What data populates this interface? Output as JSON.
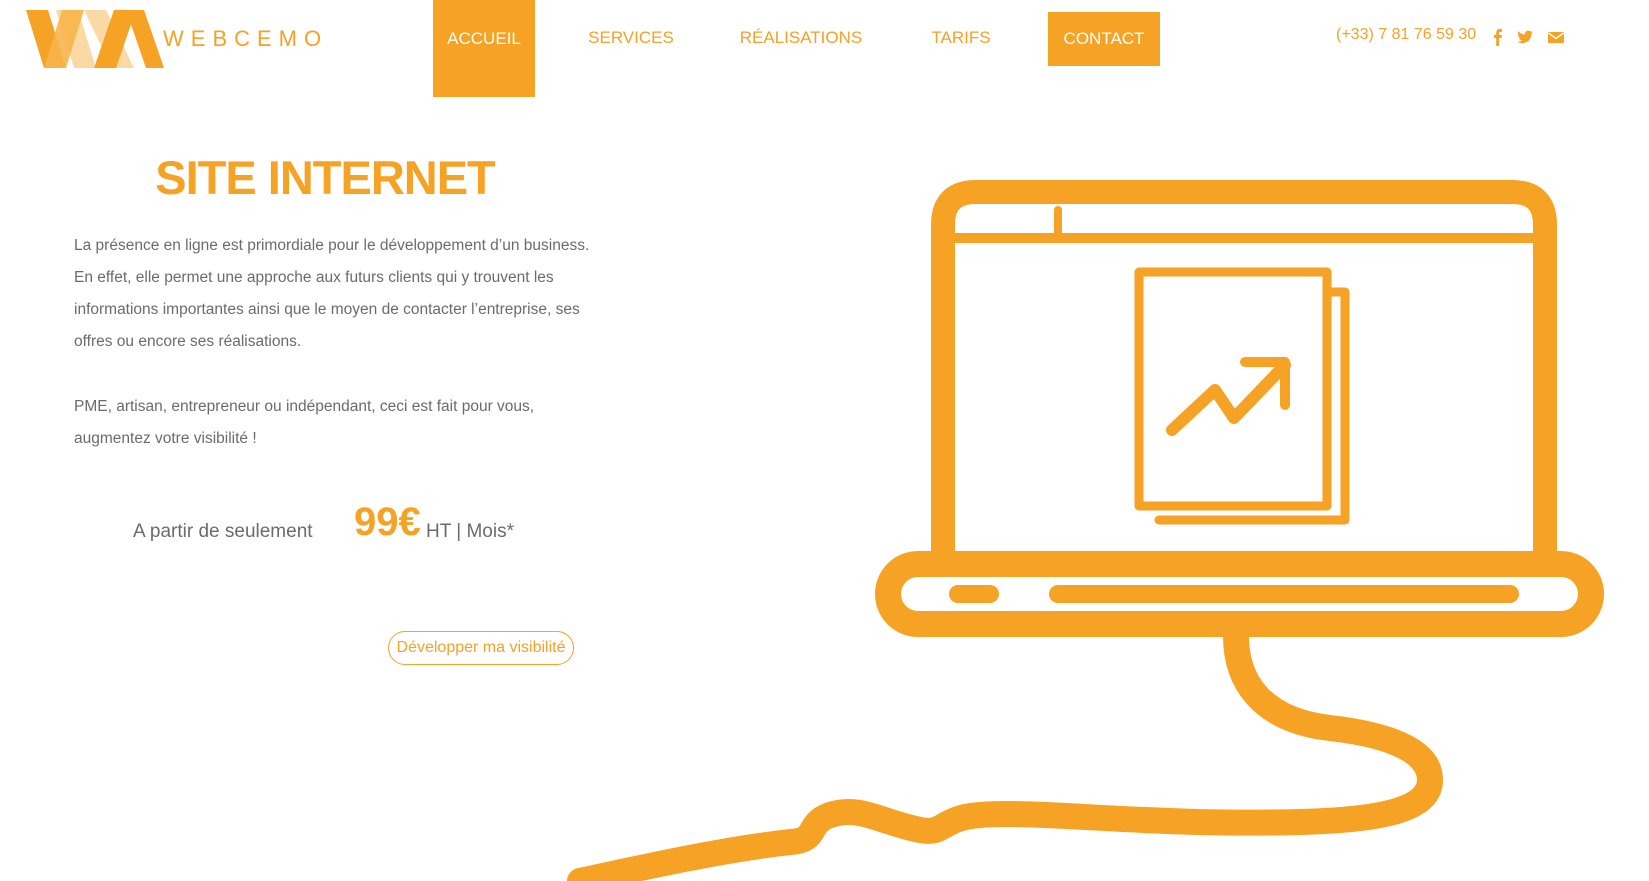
{
  "brand": {
    "name": "WEBCEMO",
    "accent": "#f5a225",
    "accent_light": "#fbd9a4",
    "text_gray": "#6b6b6b"
  },
  "nav": {
    "items": [
      {
        "label": "ACCUEIL",
        "active": true
      },
      {
        "label": "SERVICES",
        "active": false
      },
      {
        "label": "RÉALISATIONS",
        "active": false
      },
      {
        "label": "TARIFS",
        "active": false
      },
      {
        "label": "CONTACT",
        "active": false
      }
    ]
  },
  "contact": {
    "phone": "(+33) 7 81 76 59 30",
    "socials": [
      "facebook-icon",
      "twitter-icon",
      "envelope-icon"
    ]
  },
  "hero": {
    "title": "SITE INTERNET",
    "paragraph1": "La présence en ligne est primordiale pour le développement d’un business. En effet, elle permet une approche aux futurs clients qui y trouvent les informations importantes ainsi que le moyen de contacter l’entreprise, ses offres ou encore ses réalisations.",
    "paragraph2": "PME, artisan, entrepreneur ou indépendant, ceci est fait pour vous, augmentez votre visibilité !",
    "price_prefix": "A partir de seulement",
    "price_amount": "99€",
    "price_suffix": "HT | Mois*",
    "cta_label": "Développer ma visibilité"
  },
  "illustration": {
    "name": "laptop-growth-chart-illustration"
  }
}
